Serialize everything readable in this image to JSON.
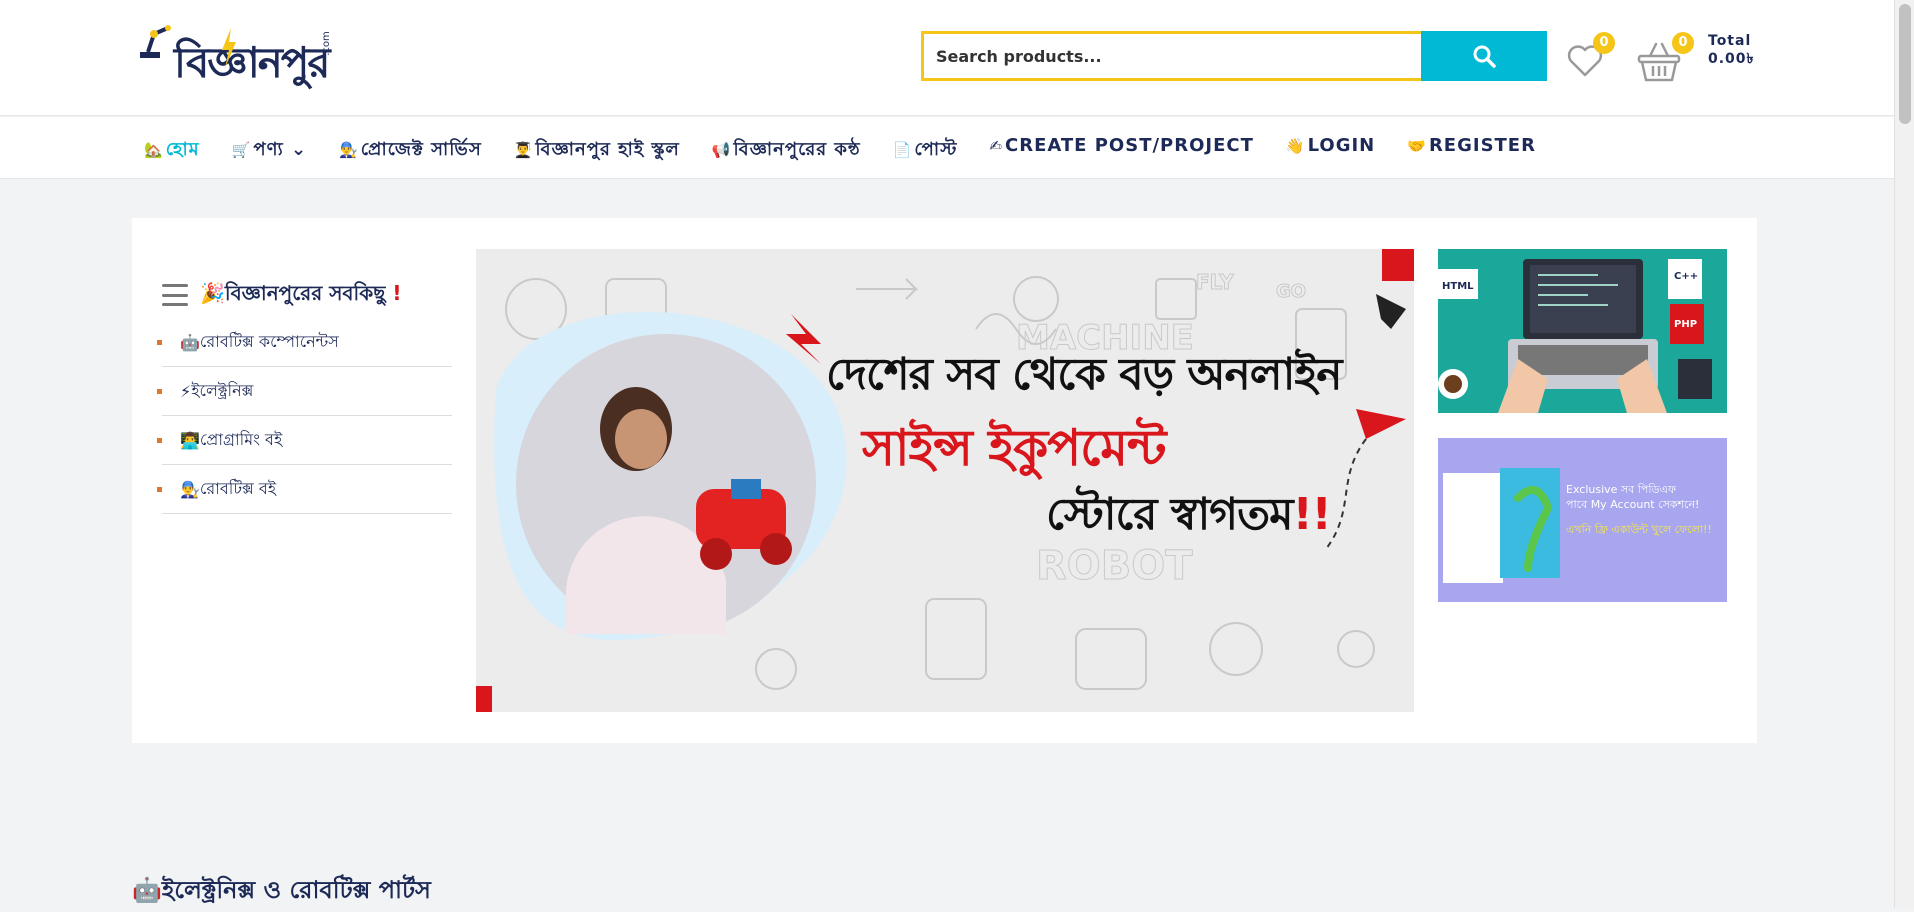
{
  "header": {
    "logo_text": "বিজ্ঞানপুর",
    "logo_suffix": ".com",
    "search_placeholder": "Search products...",
    "wishlist_count": "0",
    "cart_count": "0",
    "total_label": "Total",
    "total_value": "0.00৳"
  },
  "nav": {
    "items": [
      {
        "icon": "🏡",
        "label": "হোম"
      },
      {
        "icon": "🛒",
        "label": "পণ্য ⌄"
      },
      {
        "icon": "👨‍🔧",
        "label": "প্রোজেক্ট সার্ভিস"
      },
      {
        "icon": "👨‍🎓",
        "label": "বিজ্ঞানপুর হাই স্কুল"
      },
      {
        "icon": "📢",
        "label": "বিজ্ঞানপুরের কন্ঠ"
      },
      {
        "icon": "📄",
        "label": "পোস্ট"
      },
      {
        "icon": "✍",
        "label": "CREATE POST/PROJECT"
      },
      {
        "icon": "👋",
        "label": "LOGIN"
      },
      {
        "icon": "🤝",
        "label": "REGISTER"
      }
    ]
  },
  "categories": {
    "title_icon": "🎉",
    "title": "বিজ্ঞানপুরের সবকিছু",
    "title_mark": "!",
    "items": [
      {
        "icon": "🤖",
        "label": "রোবটিক্স কম্পোনেন্টস"
      },
      {
        "icon": "⚡",
        "label": "ইলেক্ট্রনিক্স"
      },
      {
        "icon": "👨‍💻",
        "label": "প্রোগ্রামিং বই"
      },
      {
        "icon": "👨‍🔧",
        "label": "রোবটিক্স বই"
      }
    ]
  },
  "banner": {
    "line1": "দেশের সব থেকে বড় অনলাইন",
    "line2": "সাইন্স ইকুপমেন্ট",
    "line3": "স্টোরে স্বাগতম",
    "mark": "!!",
    "bg_words": [
      "FLY",
      "GO",
      "MACHINE",
      "ROBOT"
    ]
  },
  "side_banner_2": {
    "line1": "Exclusive সব পিডিএফ",
    "line2": "পাবে My Account সেকশনে!",
    "line3": "এখনি ফ্রি একাউন্ট খুলে ফেলো!!"
  },
  "section": {
    "icon": "🤖",
    "title": "ইলেক্ট্রনিক্স ও রোবটিক্স পার্টস"
  },
  "colors": {
    "navy": "#1d2a57",
    "accent": "#00b9d4",
    "yellow": "#f5c518",
    "red": "#d8161c"
  }
}
